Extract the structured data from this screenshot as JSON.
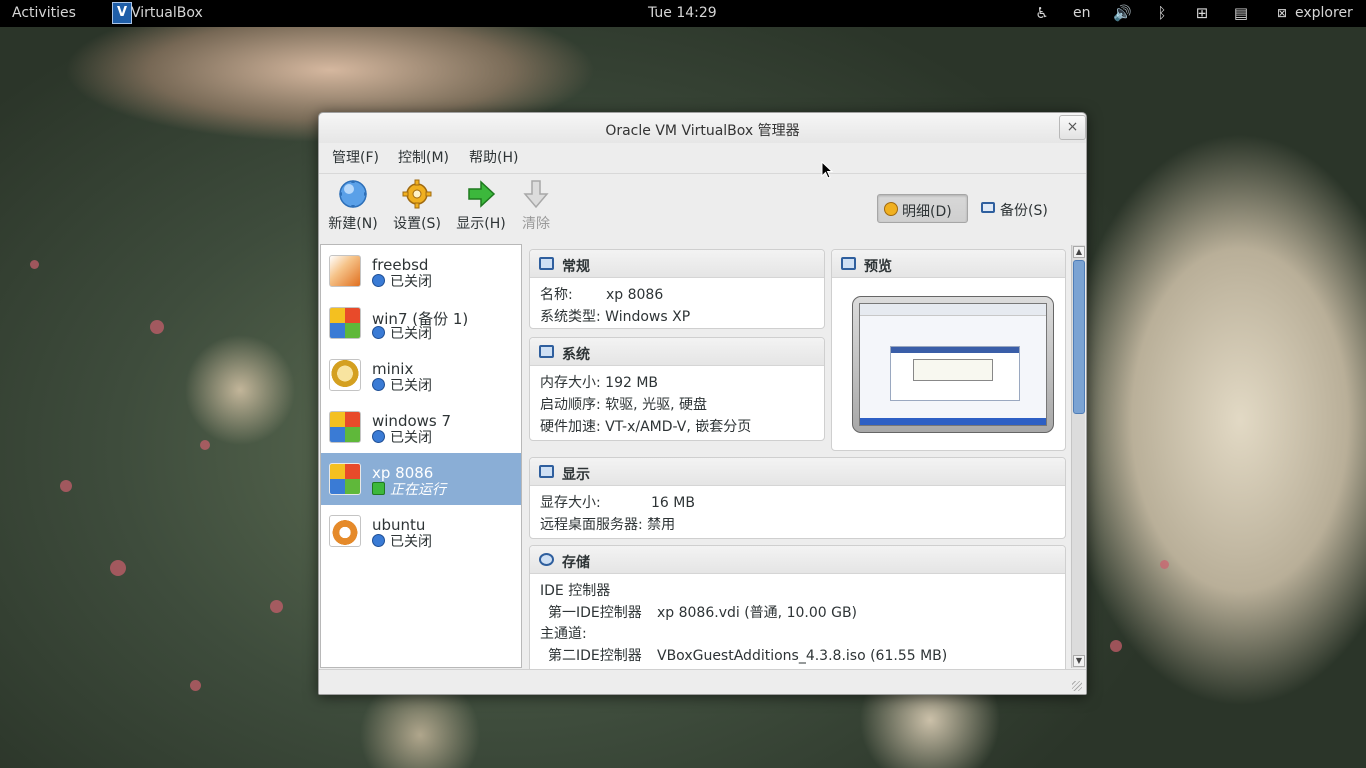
{
  "topbar": {
    "activities": "Activities",
    "app_name": "VirtualBox",
    "clock": "Tue 14:29",
    "language": "en",
    "user": "explorer"
  },
  "window": {
    "title": "Oracle VM VirtualBox 管理器",
    "close": "×",
    "menu": {
      "manage": "管理(F)",
      "control": "控制(M)",
      "help": "帮助(H)"
    },
    "toolbar": {
      "new": "新建(N)",
      "settings": "设置(S)",
      "show": "显示(H)",
      "discard": "清除"
    },
    "view_buttons": {
      "details": "明细(D)",
      "snapshots": "备份(S)"
    }
  },
  "vm_list": [
    {
      "name": "freebsd",
      "state": "已关闭",
      "color": "#e07020"
    },
    {
      "name": "win7 (备份 1)",
      "state": "已关闭",
      "color": "#3a7bd5"
    },
    {
      "name": "minix",
      "state": "已关闭",
      "color": "#d4a020"
    },
    {
      "name": "windows 7",
      "state": "已关闭",
      "color": "#3a7bd5"
    },
    {
      "name": "xp 8086",
      "state": "正在运行",
      "color": "#4a9a3a"
    },
    {
      "name": "ubuntu",
      "state": "已关闭",
      "color": "#e58a2a"
    }
  ],
  "details": {
    "general": {
      "header": "常规",
      "name_label": "名称:",
      "name_value": "xp 8086",
      "os_label": "系统类型:",
      "os_value": "Windows XP"
    },
    "system": {
      "header": "系统",
      "mem_label": "内存大小:",
      "mem_value": "192 MB",
      "boot_label": "启动顺序:",
      "boot_value": "软驱, 光驱, 硬盘",
      "accel_label": "硬件加速:",
      "accel_value": "VT-x/AMD-V, 嵌套分页"
    },
    "preview": {
      "header": "预览"
    },
    "display": {
      "header": "显示",
      "vram_label": "显存大小:",
      "vram_value": "16 MB",
      "rdp_label": "远程桌面服务器:",
      "rdp_value": "禁用"
    },
    "storage": {
      "header": "存储",
      "controller": "IDE 控制器",
      "primary_label": "第一IDE控制器",
      "primary_value": "xp 8086.vdi (普通, 10.00 GB)",
      "master_label": "主通道:",
      "secondary_label": "第二IDE控制器",
      "secondary_value": "VBoxGuestAdditions_4.3.8.iso (61.55 MB)"
    }
  },
  "colors": {
    "accent": "#8aaed6",
    "topbar": "#000000",
    "window_bg": "#ededed"
  }
}
